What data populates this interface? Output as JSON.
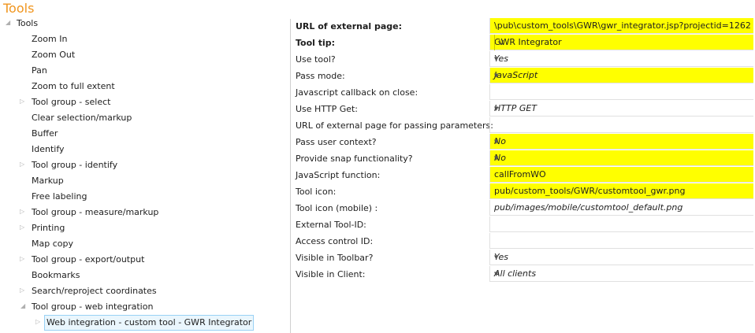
{
  "title": "Tools",
  "tree": {
    "root": "Tools",
    "items": [
      {
        "label": "Zoom In",
        "expander": false
      },
      {
        "label": "Zoom Out",
        "expander": false
      },
      {
        "label": "Pan",
        "expander": false
      },
      {
        "label": "Zoom to full extent",
        "expander": false
      },
      {
        "label": "Tool group - select",
        "expander": true
      },
      {
        "label": "Clear selection/markup",
        "expander": false
      },
      {
        "label": "Buffer",
        "expander": false
      },
      {
        "label": "Identify",
        "expander": false
      },
      {
        "label": "Tool group - identify",
        "expander": true
      },
      {
        "label": "Markup",
        "expander": false
      },
      {
        "label": "Free labeling",
        "expander": false
      },
      {
        "label": "Tool group - measure/markup",
        "expander": true
      },
      {
        "label": "Printing",
        "expander": true
      },
      {
        "label": "Map copy",
        "expander": false
      },
      {
        "label": "Tool group - export/output",
        "expander": true
      },
      {
        "label": "Bookmarks",
        "expander": false
      },
      {
        "label": "Search/reproject coordinates",
        "expander": true
      },
      {
        "label": "Tool group - web integration",
        "expander": "open"
      }
    ],
    "selected": "Web integration - custom tool - GWR Integrator"
  },
  "props": [
    {
      "label": "URL of external page:",
      "value": "\\pub\\custom_tools\\GWR\\gwr_integrator.jsp?projectid=1262",
      "bold": true,
      "yellow": true,
      "italic": false,
      "control": "text"
    },
    {
      "label": "Tool tip:",
      "value": "GWR Integrator",
      "bold": true,
      "yellow": true,
      "italic": false,
      "control": "v",
      "button": "v"
    },
    {
      "label": "Use tool?",
      "value": "Yes",
      "yellow": false,
      "italic": true,
      "control": "dropdown"
    },
    {
      "label": "Pass mode:",
      "value": "JavaScript",
      "yellow": true,
      "italic": true,
      "control": "dropdown"
    },
    {
      "label": "Javascript callback on close:",
      "value": "",
      "control": "text"
    },
    {
      "label": "Use HTTP Get:",
      "value": "HTTP GET",
      "italic": true,
      "control": "dropdown"
    },
    {
      "label": "URL of external page for passing parameters:",
      "value": "",
      "control": "text"
    },
    {
      "label": "Pass user context?",
      "value": "No",
      "yellow": true,
      "italic": true,
      "control": "dropdown"
    },
    {
      "label": "Provide snap functionality?",
      "value": "No",
      "yellow": true,
      "italic": true,
      "control": "dropdown"
    },
    {
      "label": "JavaScript function:",
      "value": "callFromWO",
      "yellow": true,
      "control": "text"
    },
    {
      "label": "Tool icon:",
      "value": "pub/custom_tools/GWR/customtool_gwr.png",
      "yellow": true,
      "control": "text"
    },
    {
      "label": "Tool icon (mobile) :",
      "value": "pub/images/mobile/customtool_default.png",
      "italic": true,
      "control": "text"
    },
    {
      "label": "External Tool-ID:",
      "value": "",
      "control": "text"
    },
    {
      "label": "Access control ID:",
      "value": "",
      "control": "text"
    },
    {
      "label": "Visible in Toolbar?",
      "value": "Yes",
      "italic": true,
      "control": "dropdown"
    },
    {
      "label": "Visible in Client:",
      "value": "All clients",
      "italic": true,
      "control": "dropdown"
    }
  ],
  "colors": {
    "title": "#f0951e",
    "highlight": "#ffff00",
    "selection": "#eaf6fd"
  }
}
